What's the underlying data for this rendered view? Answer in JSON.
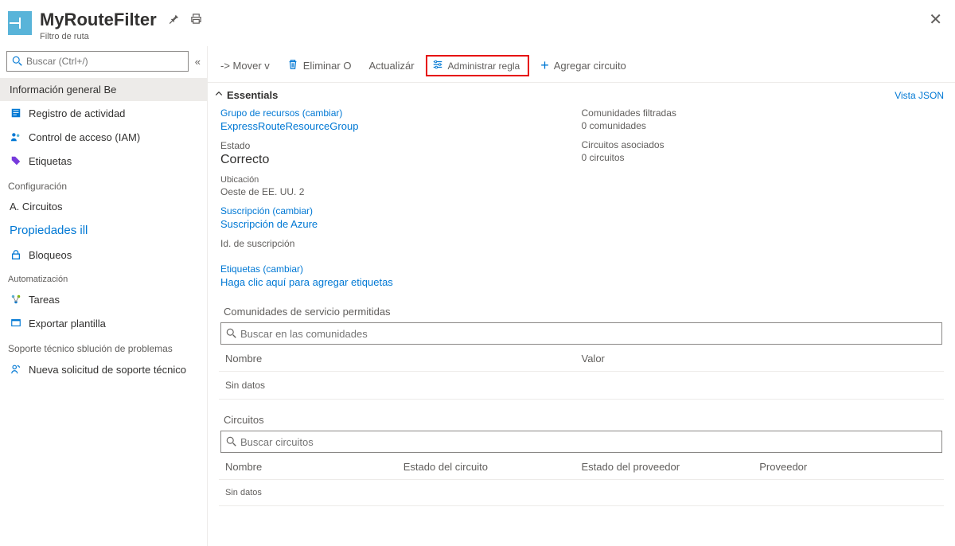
{
  "header": {
    "title": "MyRouteFilter",
    "subtitle": "Filtro de ruta"
  },
  "sidebar": {
    "search_placeholder": "Buscar (Ctrl+/)",
    "items_top": [
      {
        "label": "Información general Be"
      },
      {
        "label": "Registro de actividad"
      },
      {
        "label": "Control de acceso (IAM)"
      },
      {
        "label": "Etiquetas"
      }
    ],
    "section_config": "Configuración",
    "items_config": [
      {
        "label": "A. Circuitos"
      },
      {
        "label": "Propiedades ill"
      },
      {
        "label": "Bloqueos"
      }
    ],
    "section_auto": "Automatización",
    "items_auto": [
      {
        "label": "Tareas"
      },
      {
        "label": "Exportar plantilla"
      }
    ],
    "section_support": "Soporte técnico sblución de problemas",
    "items_support": [
      {
        "label": "Nueva solicitud de soporte técnico"
      }
    ]
  },
  "toolbar": {
    "move": "-> Mover v",
    "delete": "Eliminar O",
    "refresh": "Actualizár",
    "manage_rule": "Administrar regla",
    "add_circuit": "Agregar circuito"
  },
  "essentials": {
    "header": "Essentials",
    "json_view": "Vista JSON",
    "rg_label": "Grupo de recursos (cambiar)",
    "rg_value": "ExpressRouteResourceGroup",
    "state_label": "Estado",
    "state_value": "Correcto",
    "loc_label": "Ubicación",
    "loc_value": "Oeste de EE. UU. 2",
    "sub_label": "Suscripción (cambiar)",
    "sub_value": "Suscripción de Azure",
    "subid_label": "Id. de suscripción",
    "subid_value": "",
    "comm_label": "Comunidades filtradas",
    "comm_value": "0 comunidades",
    "circ_label": "Circuitos asociados",
    "circ_value": "0 circuitos",
    "tags_label": "Etiquetas (cambiar)",
    "tags_value": "Haga clic aquí para agregar etiquetas"
  },
  "communities": {
    "title": "Comunidades de servicio permitidas",
    "search_placeholder": "Buscar en las comunidades",
    "col_name": "Nombre",
    "col_value": "Valor",
    "no_data": "Sin datos"
  },
  "circuits": {
    "title": "Circuitos",
    "search_placeholder": "Buscar circuitos",
    "col_name": "Nombre",
    "col_state": "Estado del circuito",
    "col_provider_state": "Estado del proveedor",
    "col_provider": "Proveedor",
    "no_data": "Sin datos"
  }
}
